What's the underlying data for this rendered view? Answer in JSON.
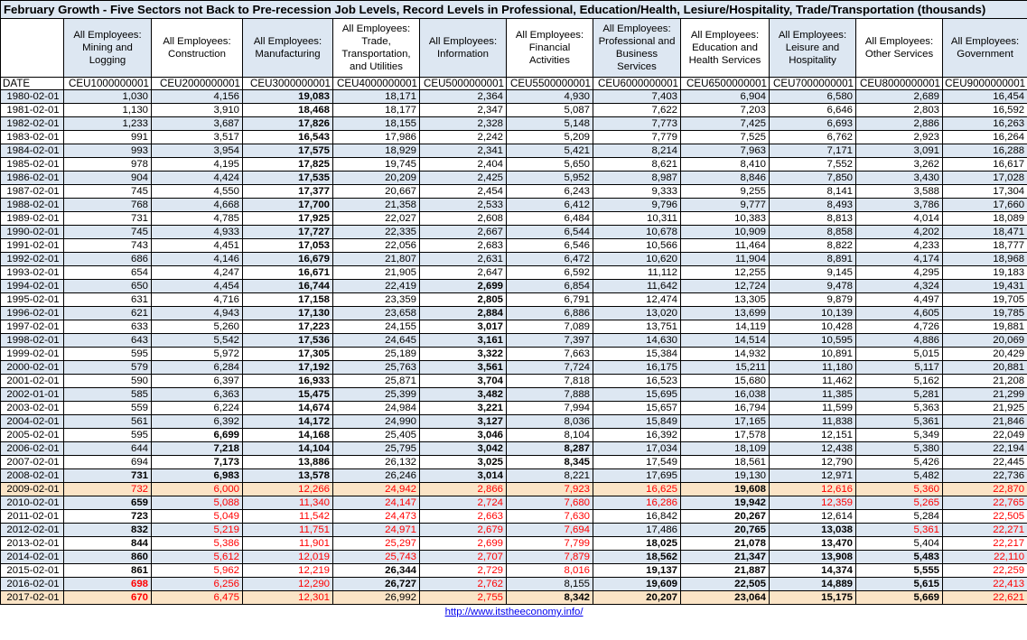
{
  "title": "February Growth - Five Sectors not Back to Pre-recession Job Levels, Record Levels in Professional, Education/Health, Lesiure/Hospitality, Trade/Transportation (thousands)",
  "columns": [
    {
      "label": "All Employees: Mining and Logging",
      "code": "CEU1000000001"
    },
    {
      "label": "All Employees: Construction",
      "code": "CEU2000000001"
    },
    {
      "label": "All Employees: Manufacturing",
      "code": "CEU3000000001"
    },
    {
      "label": "All Employees: Trade, Transportation, and Utilities",
      "code": "CEU4000000001"
    },
    {
      "label": "All Employees: Information",
      "code": "CEU5000000001"
    },
    {
      "label": "All Employees: Financial Activities",
      "code": "CEU5500000001"
    },
    {
      "label": "All Employees: Professional and Business Services",
      "code": "CEU6000000001"
    },
    {
      "label": "All Employees: Education and Health Services",
      "code": "CEU6500000001"
    },
    {
      "label": "All Employees: Leisure and Hospitality",
      "code": "CEU7000000001"
    },
    {
      "label": "All Employees: Other Services",
      "code": "CEU8000000001"
    },
    {
      "label": "All Employees: Government",
      "code": "CEU9000000001"
    }
  ],
  "date_header": "DATE",
  "rows": [
    {
      "date": "1980-02-01",
      "v": [
        "1,030",
        "4,156",
        "19,083",
        "18,171",
        "2,364",
        "4,930",
        "7,403",
        "6,904",
        "6,580",
        "2,689",
        "16,454"
      ]
    },
    {
      "date": "1981-02-01",
      "v": [
        "1,130",
        "3,910",
        "18,468",
        "18,177",
        "2,347",
        "5,087",
        "7,622",
        "7,203",
        "6,646",
        "2,803",
        "16,592"
      ]
    },
    {
      "date": "1982-02-01",
      "v": [
        "1,233",
        "3,687",
        "17,826",
        "18,155",
        "2,328",
        "5,148",
        "7,773",
        "7,425",
        "6,693",
        "2,886",
        "16,263"
      ]
    },
    {
      "date": "1983-02-01",
      "v": [
        "991",
        "3,517",
        "16,543",
        "17,986",
        "2,242",
        "5,209",
        "7,779",
        "7,525",
        "6,762",
        "2,923",
        "16,264"
      ]
    },
    {
      "date": "1984-02-01",
      "v": [
        "993",
        "3,954",
        "17,575",
        "18,929",
        "2,341",
        "5,421",
        "8,214",
        "7,963",
        "7,171",
        "3,091",
        "16,288"
      ]
    },
    {
      "date": "1985-02-01",
      "v": [
        "978",
        "4,195",
        "17,825",
        "19,745",
        "2,404",
        "5,650",
        "8,621",
        "8,410",
        "7,552",
        "3,262",
        "16,617"
      ]
    },
    {
      "date": "1986-02-01",
      "v": [
        "904",
        "4,424",
        "17,535",
        "20,209",
        "2,425",
        "5,952",
        "8,987",
        "8,846",
        "7,850",
        "3,430",
        "17,028"
      ]
    },
    {
      "date": "1987-02-01",
      "v": [
        "745",
        "4,550",
        "17,377",
        "20,667",
        "2,454",
        "6,243",
        "9,333",
        "9,255",
        "8,141",
        "3,588",
        "17,304"
      ]
    },
    {
      "date": "1988-02-01",
      "v": [
        "768",
        "4,668",
        "17,700",
        "21,358",
        "2,533",
        "6,412",
        "9,796",
        "9,777",
        "8,493",
        "3,786",
        "17,660"
      ]
    },
    {
      "date": "1989-02-01",
      "v": [
        "731",
        "4,785",
        "17,925",
        "22,027",
        "2,608",
        "6,484",
        "10,311",
        "10,383",
        "8,813",
        "4,014",
        "18,089"
      ]
    },
    {
      "date": "1990-02-01",
      "v": [
        "745",
        "4,933",
        "17,727",
        "22,335",
        "2,667",
        "6,544",
        "10,678",
        "10,909",
        "8,858",
        "4,202",
        "18,471"
      ]
    },
    {
      "date": "1991-02-01",
      "v": [
        "743",
        "4,451",
        "17,053",
        "22,056",
        "2,683",
        "6,546",
        "10,566",
        "11,464",
        "8,822",
        "4,233",
        "18,777"
      ]
    },
    {
      "date": "1992-02-01",
      "v": [
        "686",
        "4,146",
        "16,679",
        "21,807",
        "2,631",
        "6,472",
        "10,620",
        "11,904",
        "8,891",
        "4,174",
        "18,968"
      ]
    },
    {
      "date": "1993-02-01",
      "v": [
        "654",
        "4,247",
        "16,671",
        "21,905",
        "2,647",
        "6,592",
        "11,112",
        "12,255",
        "9,145",
        "4,295",
        "19,183"
      ]
    },
    {
      "date": "1994-02-01",
      "v": [
        "650",
        "4,454",
        "16,744",
        "22,419",
        "2,699",
        "6,854",
        "11,642",
        "12,724",
        "9,478",
        "4,324",
        "19,431"
      ]
    },
    {
      "date": "1995-02-01",
      "v": [
        "631",
        "4,716",
        "17,158",
        "23,359",
        "2,805",
        "6,791",
        "12,474",
        "13,305",
        "9,879",
        "4,497",
        "19,705"
      ]
    },
    {
      "date": "1996-02-01",
      "v": [
        "621",
        "4,943",
        "17,130",
        "23,658",
        "2,884",
        "6,886",
        "13,020",
        "13,699",
        "10,139",
        "4,605",
        "19,785"
      ]
    },
    {
      "date": "1997-02-01",
      "v": [
        "633",
        "5,260",
        "17,223",
        "24,155",
        "3,017",
        "7,089",
        "13,751",
        "14,119",
        "10,428",
        "4,726",
        "19,881"
      ]
    },
    {
      "date": "1998-02-01",
      "v": [
        "643",
        "5,542",
        "17,536",
        "24,645",
        "3,161",
        "7,397",
        "14,630",
        "14,514",
        "10,595",
        "4,886",
        "20,069"
      ]
    },
    {
      "date": "1999-02-01",
      "v": [
        "595",
        "5,972",
        "17,305",
        "25,189",
        "3,322",
        "7,663",
        "15,384",
        "14,932",
        "10,891",
        "5,015",
        "20,429"
      ]
    },
    {
      "date": "2000-02-01",
      "v": [
        "579",
        "6,284",
        "17,192",
        "25,763",
        "3,561",
        "7,724",
        "16,175",
        "15,211",
        "11,180",
        "5,117",
        "20,881"
      ]
    },
    {
      "date": "2001-02-01",
      "v": [
        "590",
        "6,397",
        "16,933",
        "25,871",
        "3,704",
        "7,818",
        "16,523",
        "15,680",
        "11,462",
        "5,162",
        "21,208"
      ]
    },
    {
      "date": "2002-01-01",
      "v": [
        "585",
        "6,363",
        "15,475",
        "25,399",
        "3,482",
        "7,888",
        "15,695",
        "16,038",
        "11,385",
        "5,281",
        "21,299"
      ]
    },
    {
      "date": "2003-02-01",
      "v": [
        "559",
        "6,224",
        "14,674",
        "24,984",
        "3,221",
        "7,994",
        "15,657",
        "16,794",
        "11,599",
        "5,363",
        "21,925"
      ]
    },
    {
      "date": "2004-02-01",
      "v": [
        "561",
        "6,392",
        "14,172",
        "24,990",
        "3,127",
        "8,036",
        "15,849",
        "17,165",
        "11,838",
        "5,361",
        "21,846"
      ]
    },
    {
      "date": "2005-02-01",
      "v": [
        "595",
        "6,699",
        "14,168",
        "25,405",
        "3,046",
        "8,104",
        "16,392",
        "17,578",
        "12,151",
        "5,349",
        "22,049"
      ]
    },
    {
      "date": "2006-02-01",
      "v": [
        "644",
        "7,218",
        "14,104",
        "25,795",
        "3,042",
        "8,287",
        "17,034",
        "18,109",
        "12,438",
        "5,380",
        "22,194"
      ]
    },
    {
      "date": "2007-02-01",
      "v": [
        "694",
        "7,173",
        "13,886",
        "26,132",
        "3,025",
        "8,345",
        "17,549",
        "18,561",
        "12,790",
        "5,426",
        "22,445"
      ]
    },
    {
      "date": "2008-02-01",
      "v": [
        "731",
        "6,983",
        "13,578",
        "26,246",
        "3,014",
        "8,221",
        "17,695",
        "19,130",
        "12,971",
        "5,482",
        "22,736"
      ]
    },
    {
      "date": "2009-02-01",
      "v": [
        "732",
        "6,000",
        "12,266",
        "24,942",
        "2,866",
        "7,923",
        "16,625",
        "19,608",
        "12,616",
        "5,360",
        "22,870"
      ]
    },
    {
      "date": "2010-02-01",
      "v": [
        "659",
        "5,088",
        "11,340",
        "24,147",
        "2,724",
        "7,680",
        "16,286",
        "19,942",
        "12,359",
        "5,265",
        "22,765"
      ]
    },
    {
      "date": "2011-02-01",
      "v": [
        "723",
        "5,049",
        "11,542",
        "24,473",
        "2,663",
        "7,630",
        "16,842",
        "20,267",
        "12,614",
        "5,284",
        "22,505"
      ]
    },
    {
      "date": "2012-02-01",
      "v": [
        "832",
        "5,219",
        "11,751",
        "24,971",
        "2,679",
        "7,694",
        "17,486",
        "20,765",
        "13,038",
        "5,361",
        "22,271"
      ]
    },
    {
      "date": "2013-02-01",
      "v": [
        "844",
        "5,386",
        "11,901",
        "25,297",
        "2,699",
        "7,799",
        "18,025",
        "21,078",
        "13,470",
        "5,404",
        "22,217"
      ]
    },
    {
      "date": "2014-02-01",
      "v": [
        "860",
        "5,612",
        "12,019",
        "25,743",
        "2,707",
        "7,879",
        "18,562",
        "21,347",
        "13,908",
        "5,483",
        "22,110"
      ]
    },
    {
      "date": "2015-02-01",
      "v": [
        "861",
        "5,962",
        "12,219",
        "26,344",
        "2,729",
        "8,016",
        "19,137",
        "21,887",
        "14,374",
        "5,555",
        "22,259"
      ]
    },
    {
      "date": "2016-02-01",
      "v": [
        "698",
        "6,256",
        "12,290",
        "26,727",
        "2,762",
        "8,155",
        "19,609",
        "22,505",
        "14,889",
        "5,615",
        "22,413"
      ]
    },
    {
      "date": "2017-02-01",
      "v": [
        "670",
        "6,475",
        "12,301",
        "26,992",
        "2,755",
        "8,342",
        "20,207",
        "23,064",
        "15,175",
        "5,669",
        "22,621"
      ]
    }
  ],
  "highlight_colors": {
    "blue": "#dde7f2",
    "orange": "#fbe4c6",
    "red_text": "#ff0000"
  },
  "footer_link": "http://www.itstheeconomy.info/"
}
